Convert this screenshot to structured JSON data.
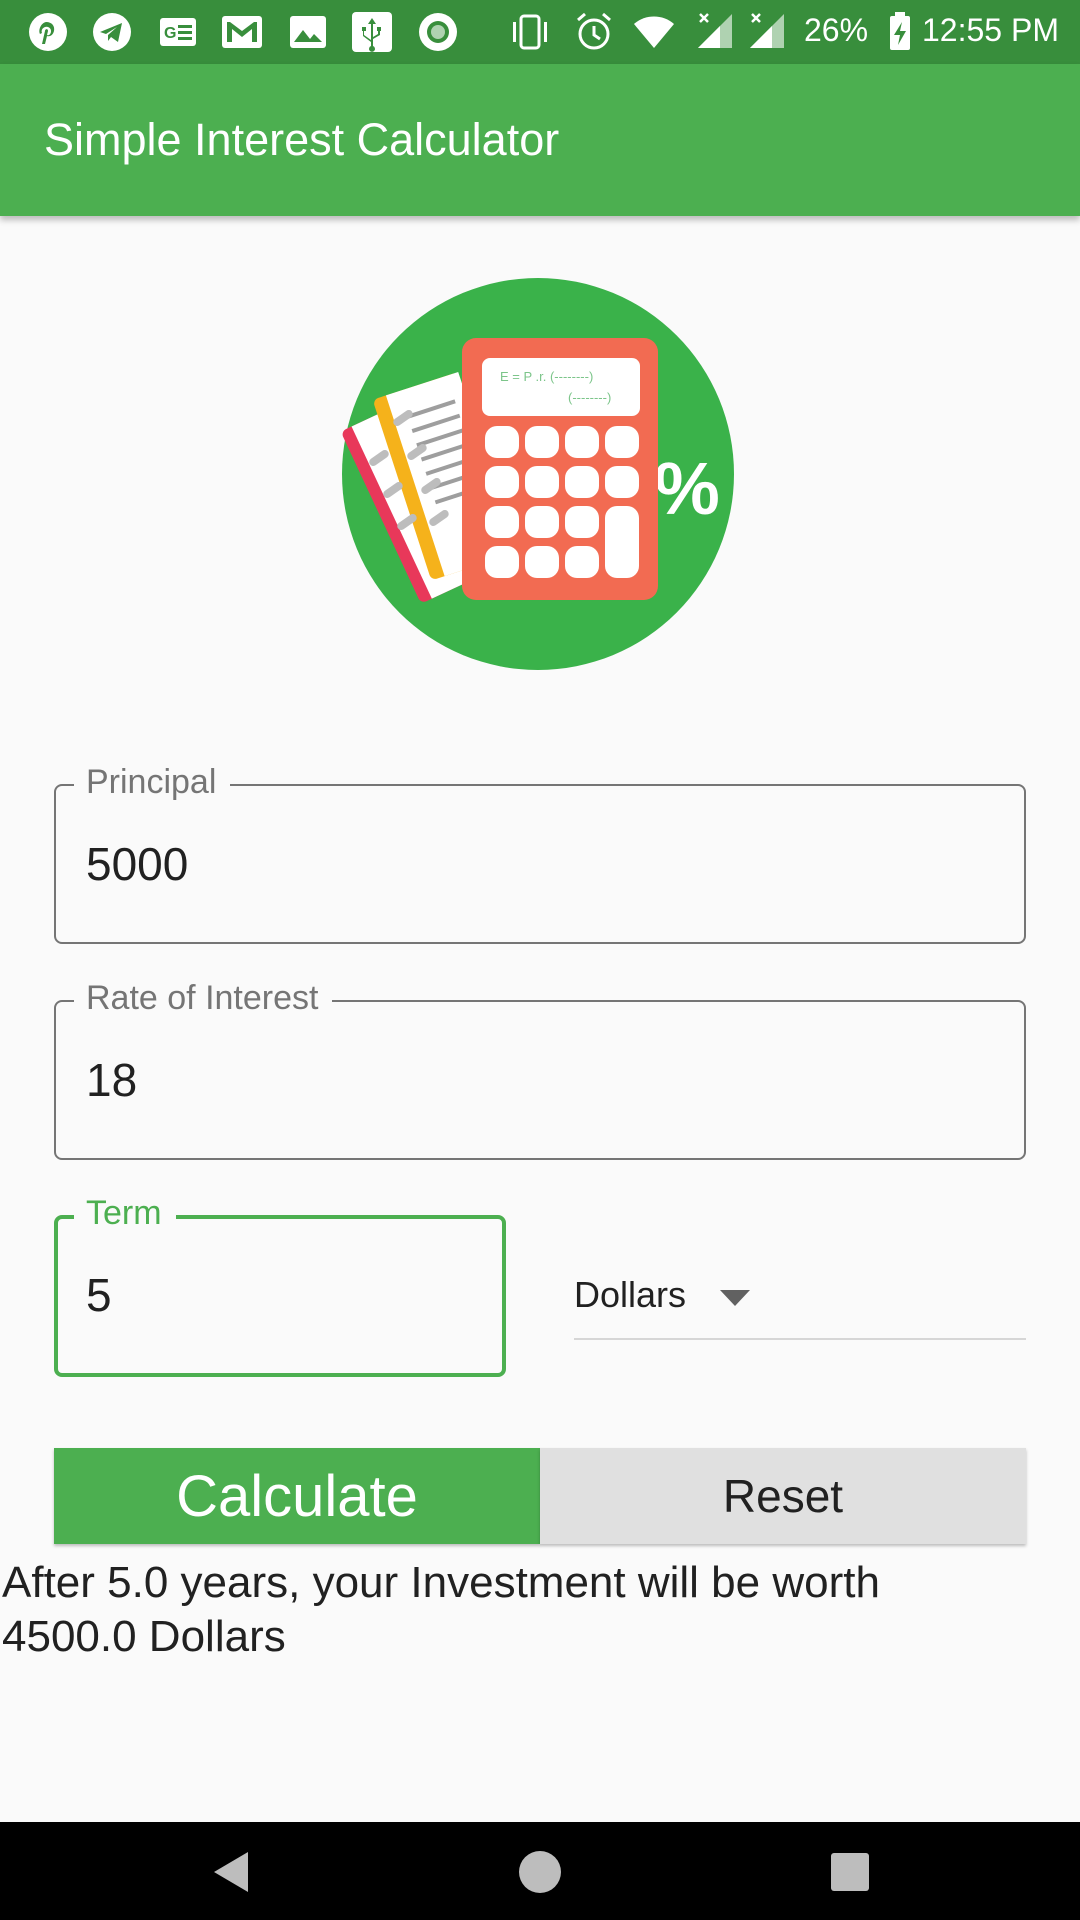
{
  "status_bar": {
    "battery": "26%",
    "time": "12:55 PM",
    "notification_icons": [
      "pinterest-icon",
      "telegram-icon",
      "news-icon",
      "gmail-icon",
      "image-icon",
      "usb-icon",
      "record-icon"
    ],
    "system_icons": [
      "vibrate-icon",
      "alarm-icon",
      "wifi-icon",
      "signal-icon",
      "signal-icon",
      "battery-charging-icon"
    ]
  },
  "app_bar": {
    "title": "Simple Interest Calculator"
  },
  "logo": {
    "formula_line1": "E = P .r.  (--------)",
    "formula_line2": "(--------)",
    "percent_sign": "%"
  },
  "form": {
    "principal": {
      "label": "Principal",
      "value": "5000"
    },
    "rate": {
      "label": "Rate of Interest",
      "value": "18"
    },
    "term": {
      "label": "Term",
      "value": "5"
    },
    "currency": {
      "selected": "Dollars"
    }
  },
  "buttons": {
    "calculate": "Calculate",
    "reset": "Reset"
  },
  "result": {
    "text": "After 5.0 years, your Investment will be worth 4500.0 Dollars"
  },
  "colors": {
    "primary": "#4caf50",
    "primary_dark": "#388e3c",
    "calculator_body": "#f26b52",
    "background": "#fafafa",
    "reset_button": "#e0e0e0"
  }
}
